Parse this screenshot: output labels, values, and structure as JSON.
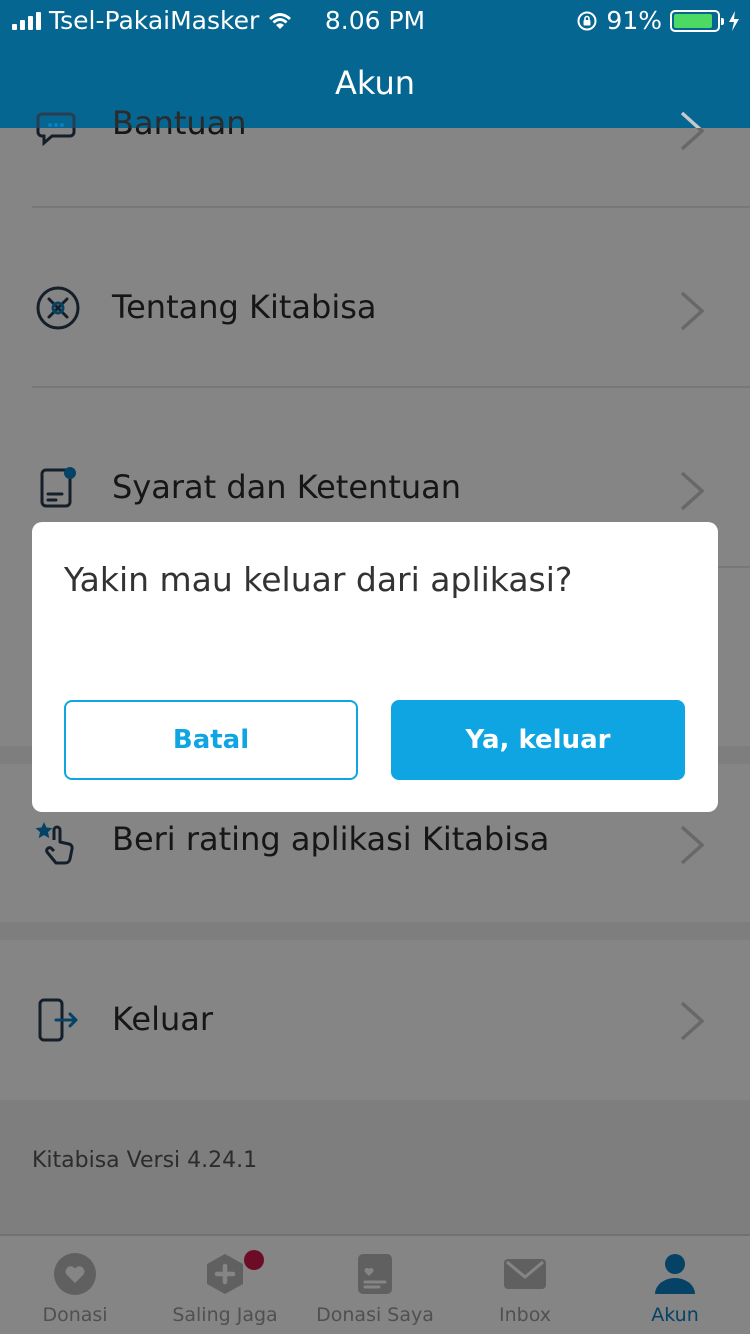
{
  "status_bar": {
    "carrier": "Tsel-PakaiMasker",
    "time": "8.06 PM",
    "battery": "91%",
    "battery_level": 0.91
  },
  "header": {
    "title": "Akun"
  },
  "menu": [
    {
      "label": "Bantuan",
      "icon": "help-chat-icon"
    },
    {
      "label": "Tentang Kitabisa",
      "icon": "kitabisa-logo-icon"
    },
    {
      "label": "Syarat dan Ketentuan",
      "icon": "document-badge-icon"
    },
    {
      "label": "Beri rating aplikasi Kitabisa",
      "icon": "star-tap-icon"
    },
    {
      "label": "Keluar",
      "icon": "logout-icon"
    }
  ],
  "version": "Kitabisa Versi 4.24.1",
  "tabs": [
    {
      "label": "Donasi",
      "icon": "heart-icon",
      "active": false
    },
    {
      "label": "Saling Jaga",
      "icon": "plus-shield-icon",
      "active": false,
      "badge": true
    },
    {
      "label": "Donasi Saya",
      "icon": "donation-list-icon",
      "active": false
    },
    {
      "label": "Inbox",
      "icon": "mail-icon",
      "active": false
    },
    {
      "label": "Akun",
      "icon": "user-icon",
      "active": true
    }
  ],
  "dialog": {
    "title": "Yakin mau keluar dari aplikasi?",
    "cancel_label": "Batal",
    "confirm_label": "Ya, keluar"
  },
  "colors": {
    "header_bg": "#056691",
    "accent": "#0ea5e2",
    "active_tab": "#0a7fc4",
    "badge": "#d0174c"
  }
}
